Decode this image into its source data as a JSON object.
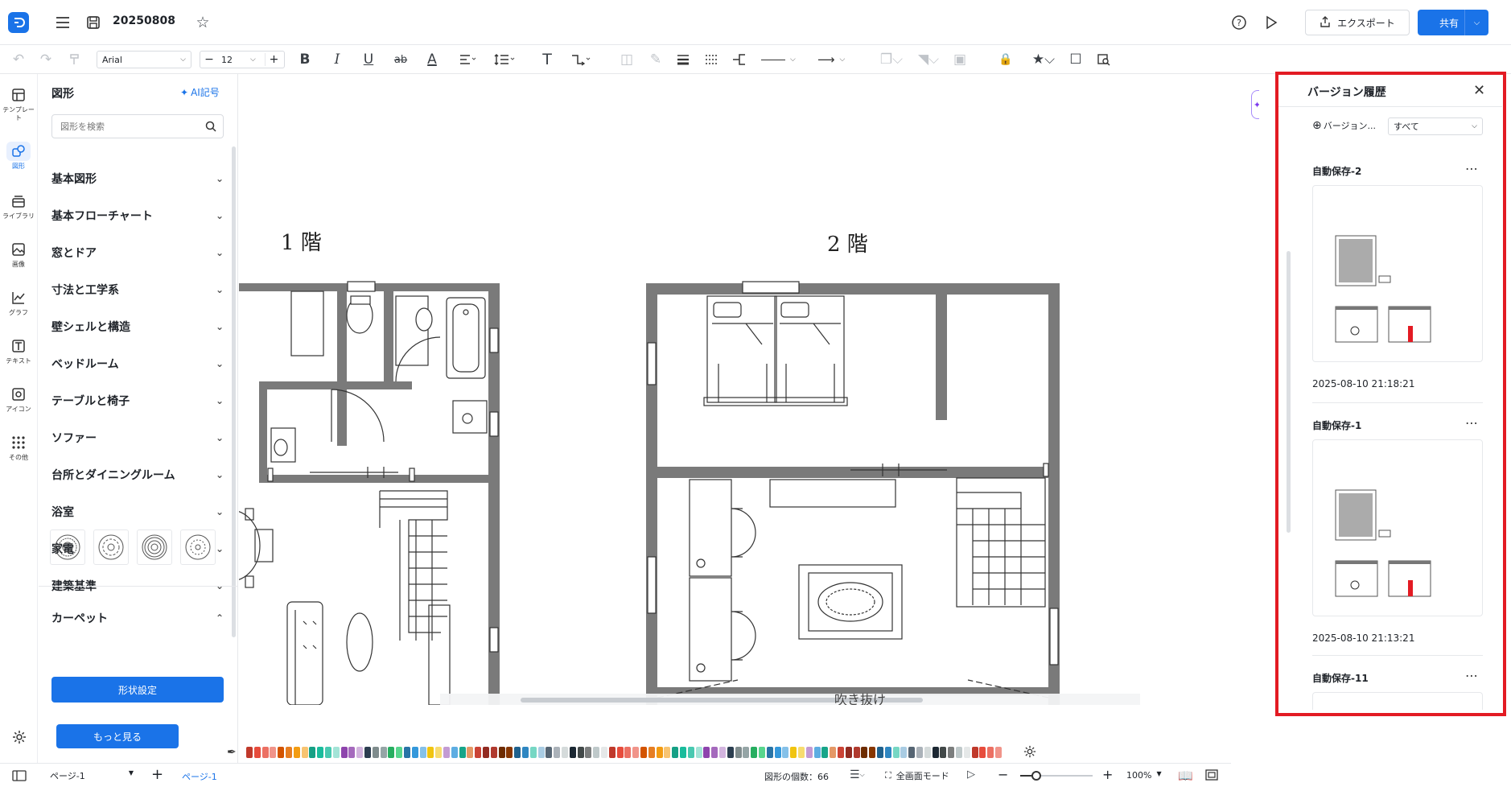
{
  "header": {
    "doc_title": "20250808",
    "export_label": "エクスポート",
    "share_label": "共有"
  },
  "toolbar": {
    "font_name": "Arial",
    "font_size": "12"
  },
  "left_rail": {
    "items": [
      {
        "label": "テンプレート",
        "icon": "template-icon"
      },
      {
        "label": "図形",
        "icon": "shapes-icon"
      },
      {
        "label": "ライブラリ",
        "icon": "library-icon"
      },
      {
        "label": "画像",
        "icon": "image-icon"
      },
      {
        "label": "グラフ",
        "icon": "chart-icon"
      },
      {
        "label": "テキスト",
        "icon": "text-icon"
      },
      {
        "label": "アイコン",
        "icon": "icon-icon"
      },
      {
        "label": "その他",
        "icon": "more-icon"
      }
    ]
  },
  "shape_panel": {
    "title": "図形",
    "ai_label": "AI記号",
    "search_placeholder": "図形を検索",
    "categories": [
      {
        "label": "基本図形",
        "expanded": false
      },
      {
        "label": "基本フローチャート",
        "expanded": false
      },
      {
        "label": "窓とドア",
        "expanded": false
      },
      {
        "label": "寸法と工学系",
        "expanded": false
      },
      {
        "label": "壁シェルと構造",
        "expanded": false
      },
      {
        "label": "ベッドルーム",
        "expanded": false
      },
      {
        "label": "テーブルと椅子",
        "expanded": false
      },
      {
        "label": "ソファー",
        "expanded": false
      },
      {
        "label": "台所とダイニングルーム",
        "expanded": false
      },
      {
        "label": "浴室",
        "expanded": false
      },
      {
        "label": "家電",
        "expanded": false
      },
      {
        "label": "建築基準",
        "expanded": false
      },
      {
        "label": "カーペット",
        "expanded": true
      }
    ],
    "shape_settings_label": "形状設定",
    "more_label": "もっと見る"
  },
  "canvas": {
    "floor1_label": "1 階",
    "floor2_label": "2 階",
    "fukinuke_label": "吹き抜け"
  },
  "status": {
    "page_select": "ページ-1",
    "page_tab": "ページ-1",
    "shape_count": "図形の個数：66",
    "fullscreen_label": "全画面モード",
    "zoom": "100%"
  },
  "version_panel": {
    "title": "バージョン履歴",
    "add_label": "バージョン...",
    "filter_value": "すべて",
    "versions": [
      {
        "name": "自動保存-2",
        "time": "2025-08-10 21:18:21"
      },
      {
        "name": "自動保存-1",
        "time": "2025-08-10 21:13:21"
      },
      {
        "name": "自動保存-11",
        "time": ""
      }
    ]
  },
  "colors": {
    "accent": "#1a73e8",
    "highlight": "#e31b23",
    "wall": "#7a7a7a"
  }
}
